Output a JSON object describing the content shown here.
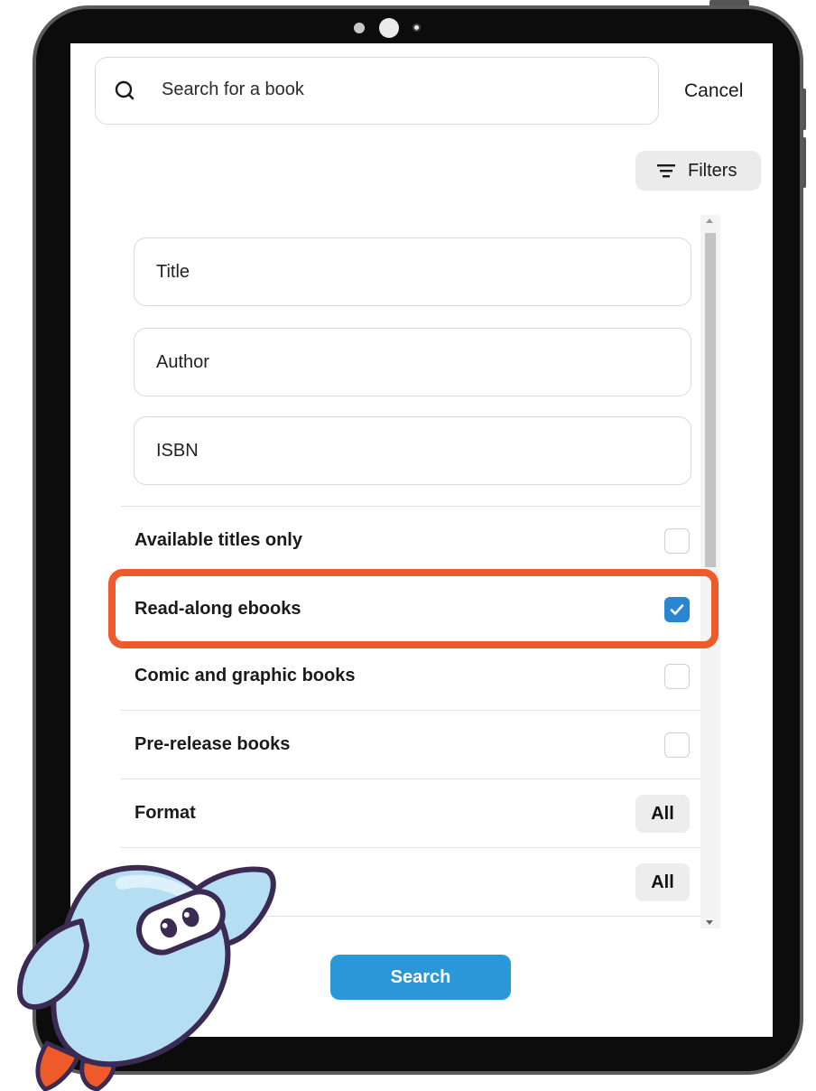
{
  "search": {
    "placeholder": "Search for a book",
    "cancel_label": "Cancel"
  },
  "filters_button": {
    "label": "Filters"
  },
  "fields": [
    {
      "label": "Title"
    },
    {
      "label": "Author"
    },
    {
      "label": "ISBN"
    }
  ],
  "options": [
    {
      "label": "Available titles only",
      "checked": false
    },
    {
      "label": "Read-along ebooks",
      "checked": true
    },
    {
      "label": "Comic and graphic books",
      "checked": false
    },
    {
      "label": "Pre-release books",
      "checked": false
    }
  ],
  "selects": [
    {
      "label": "Format",
      "value": "All"
    },
    {
      "label": "",
      "value": "All"
    }
  ],
  "search_button": {
    "label": "Search"
  },
  "colors": {
    "highlight": "#ee5a2b",
    "accent": "#2a98d8",
    "checkbox_checked": "#2a86d1"
  },
  "icons": [
    "search-icon",
    "filter-lines-icon",
    "checkmark-icon",
    "mascot-illustration"
  ]
}
